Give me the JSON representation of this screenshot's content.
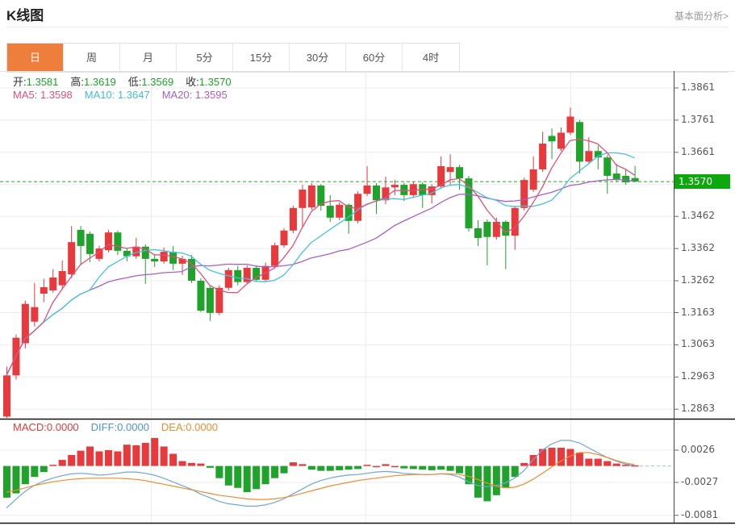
{
  "header": {
    "title": "K线图",
    "link": "基本面分析>"
  },
  "tabs": {
    "items": [
      {
        "label": "日",
        "active": true
      },
      {
        "label": "周",
        "active": false
      },
      {
        "label": "月",
        "active": false
      },
      {
        "label": "5分",
        "active": false
      },
      {
        "label": "15分",
        "active": false
      },
      {
        "label": "30分",
        "active": false
      },
      {
        "label": "60分",
        "active": false
      },
      {
        "label": "4时",
        "active": false
      }
    ]
  },
  "ohlc_legend": {
    "open_label": "开:",
    "open": "1.3581",
    "high_label": "高:",
    "high": "1.3619",
    "low_label": "低:",
    "low": "1.3569",
    "close_label": "收:",
    "close": "1.3570"
  },
  "ma_legend": {
    "ma5_label": "MA5:",
    "ma5": "1.3598",
    "ma10_label": "MA10:",
    "ma10": "1.3647",
    "ma20_label": "MA20:",
    "ma20": "1.3595"
  },
  "macd_legend": {
    "macd_label": "MACD:",
    "macd": "0.0000",
    "diff_label": "DIFF:",
    "diff": "0.0000",
    "dea_label": "DEA:",
    "dea": "0.0000"
  },
  "colors": {
    "up_candle": "#e8393d",
    "down_candle": "#1fa32b",
    "price_badge": "#0da80d",
    "ma5": "#e0507a",
    "ma10": "#44c3dc",
    "ma20": "#a75fc9",
    "diff_line": "#6fa7d8",
    "dea_line": "#ef8c30",
    "macd_pos_bar": "#e8393d",
    "macd_neg_bar": "#1fa32b",
    "active_tab": "#ee7e3c",
    "current_price_dash": "#2aa02c",
    "grid": "#ededed",
    "axis_text": "#555555"
  },
  "chart_data": {
    "type": "candlestick",
    "title": "K线图 (daily K-line with MA5/MA10/MA20 and MACD)",
    "legend_position": "top-left overlay",
    "grid": true,
    "main": {
      "current_price": "1.3570",
      "current_price_value": 1.357,
      "price_axis_labels": [
        "1.3861",
        "1.3761",
        "1.3661",
        "1.3462",
        "1.3362",
        "1.3262",
        "1.3163",
        "1.3063",
        "1.2963",
        "1.2863"
      ],
      "grid_prices": [
        1.3861,
        1.3761,
        1.3661,
        1.3562,
        1.3462,
        1.3362,
        1.3262,
        1.3163,
        1.3063,
        1.2963,
        1.2863
      ],
      "ylim": [
        1.2836,
        1.3913
      ],
      "ma_periods": [
        5,
        10,
        20
      ],
      "candles_ohlc": [
        [
          1.284,
          1.2995,
          1.2836,
          1.2968
        ],
        [
          1.2968,
          1.3095,
          1.2955,
          1.3085
        ],
        [
          1.3068,
          1.32,
          1.3052,
          1.319
        ],
        [
          1.3135,
          1.3255,
          1.312,
          1.318
        ],
        [
          1.3222,
          1.3268,
          1.3195,
          1.3242
        ],
        [
          1.3232,
          1.3298,
          1.3225,
          1.3272
        ],
        [
          1.3248,
          1.3325,
          1.324,
          1.3292
        ],
        [
          1.3282,
          1.3432,
          1.327,
          1.3382
        ],
        [
          1.342,
          1.3432,
          1.3312,
          1.337
        ],
        [
          1.3408,
          1.3415,
          1.332,
          1.3345
        ],
        [
          1.333,
          1.337,
          1.3322,
          1.3362
        ],
        [
          1.3357,
          1.342,
          1.335,
          1.3412
        ],
        [
          1.3412,
          1.3418,
          1.3342,
          1.3355
        ],
        [
          1.3355,
          1.3362,
          1.3322,
          1.3338
        ],
        [
          1.3338,
          1.3395,
          1.333,
          1.3368
        ],
        [
          1.3368,
          1.3375,
          1.3252,
          1.333
        ],
        [
          1.333,
          1.3345,
          1.3305,
          1.3322
        ],
        [
          1.3322,
          1.3365,
          1.3315,
          1.3352
        ],
        [
          1.3352,
          1.337,
          1.3295,
          1.3315
        ],
        [
          1.3315,
          1.334,
          1.328,
          1.333
        ],
        [
          1.333,
          1.3342,
          1.3255,
          1.3262
        ],
        [
          1.3262,
          1.327,
          1.3165,
          1.3169
        ],
        [
          1.324,
          1.3248,
          1.3137,
          1.3162
        ],
        [
          1.3162,
          1.3248,
          1.3155,
          1.324
        ],
        [
          1.324,
          1.3302,
          1.3232,
          1.3295
        ],
        [
          1.3295,
          1.3308,
          1.3248,
          1.3258
        ],
        [
          1.3258,
          1.331,
          1.3252,
          1.3302
        ],
        [
          1.3302,
          1.331,
          1.3258,
          1.3265
        ],
        [
          1.3265,
          1.3318,
          1.326,
          1.3308
        ],
        [
          1.3308,
          1.338,
          1.33,
          1.3372
        ],
        [
          1.3372,
          1.3425,
          1.3365,
          1.3418
        ],
        [
          1.3418,
          1.3495,
          1.341,
          1.3488
        ],
        [
          1.3488,
          1.356,
          1.343,
          1.3545
        ],
        [
          1.349,
          1.3565,
          1.3482,
          1.3558
        ],
        [
          1.3558,
          1.3562,
          1.348,
          1.3495
        ],
        [
          1.3495,
          1.3528,
          1.3445,
          1.3458
        ],
        [
          1.3458,
          1.3505,
          1.345,
          1.3498
        ],
        [
          1.3498,
          1.3502,
          1.3408,
          1.3448
        ],
        [
          1.3448,
          1.354,
          1.344,
          1.3532
        ],
        [
          1.3532,
          1.3618,
          1.3525,
          1.3558
        ],
        [
          1.3558,
          1.3565,
          1.347,
          1.3512
        ],
        [
          1.3512,
          1.3585,
          1.35,
          1.3552
        ],
        [
          1.3552,
          1.3575,
          1.3528,
          1.356
        ],
        [
          1.356,
          1.3566,
          1.351,
          1.3528
        ],
        [
          1.3528,
          1.357,
          1.352,
          1.3562
        ],
        [
          1.3562,
          1.3568,
          1.3488,
          1.3528
        ],
        [
          1.3528,
          1.3562,
          1.3502,
          1.3555
        ],
        [
          1.3555,
          1.3648,
          1.3548,
          1.3618
        ],
        [
          1.36,
          1.3655,
          1.3558,
          1.3615
        ],
        [
          1.3615,
          1.3622,
          1.3545,
          1.358
        ],
        [
          1.358,
          1.3588,
          1.3415,
          1.3425
        ],
        [
          1.3425,
          1.345,
          1.337,
          1.3395
        ],
        [
          1.3445,
          1.3452,
          1.331,
          1.3398
        ],
        [
          1.3398,
          1.3458,
          1.339,
          1.3445
        ],
        [
          1.3445,
          1.345,
          1.3298,
          1.3402
        ],
        [
          1.3402,
          1.3495,
          1.3358,
          1.3488
        ],
        [
          1.3488,
          1.3582,
          1.348,
          1.3575
        ],
        [
          1.3545,
          1.3648,
          1.3538,
          1.3608
        ],
        [
          1.3608,
          1.3725,
          1.36,
          1.3688
        ],
        [
          1.3712,
          1.3735,
          1.364,
          1.3695
        ],
        [
          1.3672,
          1.3738,
          1.3665,
          1.3722
        ],
        [
          1.3722,
          1.38,
          1.3715,
          1.3772
        ],
        [
          1.3755,
          1.3762,
          1.3595,
          1.3632
        ],
        [
          1.3632,
          1.3708,
          1.3625,
          1.3665
        ],
        [
          1.3665,
          1.3682,
          1.3608,
          1.3645
        ],
        [
          1.3645,
          1.3652,
          1.3532,
          1.3588
        ],
        [
          1.3595,
          1.3625,
          1.357,
          1.3578
        ],
        [
          1.3588,
          1.3608,
          1.356,
          1.3568
        ],
        [
          1.3581,
          1.3619,
          1.3569,
          1.357
        ]
      ]
    },
    "macd": {
      "axis_labels": [
        "0.0026",
        "-0.0027",
        "-0.0081"
      ],
      "hist": [
        -0.0052,
        -0.0045,
        -0.003,
        -0.0018,
        -0.001,
        0.0002,
        0.001,
        0.0018,
        0.0025,
        0.0032,
        0.0024,
        0.0026,
        0.0024,
        0.0035,
        0.0034,
        0.0038,
        0.0046,
        0.0032,
        0.002,
        0.0008,
        0.0005,
        0.0004,
        -0.0003,
        -0.002,
        -0.0032,
        -0.0036,
        -0.0043,
        -0.0038,
        -0.003,
        -0.002,
        -0.0012,
        0.0006,
        0.0003,
        -0.0006,
        -0.0008,
        -0.0008,
        -0.0007,
        -0.0006,
        -0.0005,
        0.0002,
        0.0,
        0.0003,
        0.0,
        -0.0004,
        -0.0005,
        -0.0006,
        -0.0007,
        -0.0006,
        -0.0008,
        -0.0012,
        -0.003,
        -0.0052,
        -0.0058,
        -0.0048,
        -0.0035,
        -0.0018,
        0.0005,
        0.0018,
        0.0028,
        0.003,
        0.003,
        0.0028,
        0.0022,
        0.0012,
        0.0012,
        0.0008,
        0.0004,
        0.0002,
        0.0001
      ],
      "diff": [
        -0.0069,
        -0.0055,
        -0.0042,
        -0.0032,
        -0.0025,
        -0.002,
        -0.0016,
        -0.0013,
        -0.0012,
        -0.0013,
        -0.0015,
        -0.0014,
        -0.0012,
        -0.001,
        -0.001,
        -0.0012,
        -0.0015,
        -0.002,
        -0.0026,
        -0.0032,
        -0.0038,
        -0.0046,
        -0.0052,
        -0.0058,
        -0.0062,
        -0.0064,
        -0.0066,
        -0.0066,
        -0.0064,
        -0.006,
        -0.0054,
        -0.0046,
        -0.0038,
        -0.003,
        -0.0024,
        -0.002,
        -0.0017,
        -0.0015,
        -0.0014,
        -0.0012,
        -0.001,
        -0.0009,
        -0.001,
        -0.0012,
        -0.0013,
        -0.0014,
        -0.0014,
        -0.0013,
        -0.0014,
        -0.0018,
        -0.0026,
        -0.0032,
        -0.0034,
        -0.0032,
        -0.0028,
        -0.002,
        -0.0008,
        0.001,
        0.0026,
        0.0036,
        0.0042,
        0.0042,
        0.0038,
        0.003,
        0.0022,
        0.0014,
        0.0008,
        0.0003,
        0.0001
      ],
      "dea": [
        -0.0043,
        -0.004,
        -0.0036,
        -0.0032,
        -0.0029,
        -0.0026,
        -0.0024,
        -0.0022,
        -0.0021,
        -0.002,
        -0.002,
        -0.002,
        -0.002,
        -0.0021,
        -0.0022,
        -0.0024,
        -0.0027,
        -0.003,
        -0.0033,
        -0.0036,
        -0.0039,
        -0.0042,
        -0.0045,
        -0.0048,
        -0.005,
        -0.0052,
        -0.0054,
        -0.0055,
        -0.0055,
        -0.0054,
        -0.0052,
        -0.0049,
        -0.0045,
        -0.0041,
        -0.0037,
        -0.0033,
        -0.003,
        -0.0027,
        -0.0024,
        -0.0022,
        -0.002,
        -0.0018,
        -0.0016,
        -0.0015,
        -0.0014,
        -0.0014,
        -0.0014,
        -0.0013,
        -0.0013,
        -0.0014,
        -0.0017,
        -0.0022,
        -0.0028,
        -0.0033,
        -0.0036,
        -0.0035,
        -0.003,
        -0.0022,
        -0.0012,
        -0.0002,
        0.0008,
        0.0016,
        0.0022,
        0.0022,
        0.0019,
        0.0014,
        0.0009,
        0.0005,
        0.0002
      ]
    }
  }
}
